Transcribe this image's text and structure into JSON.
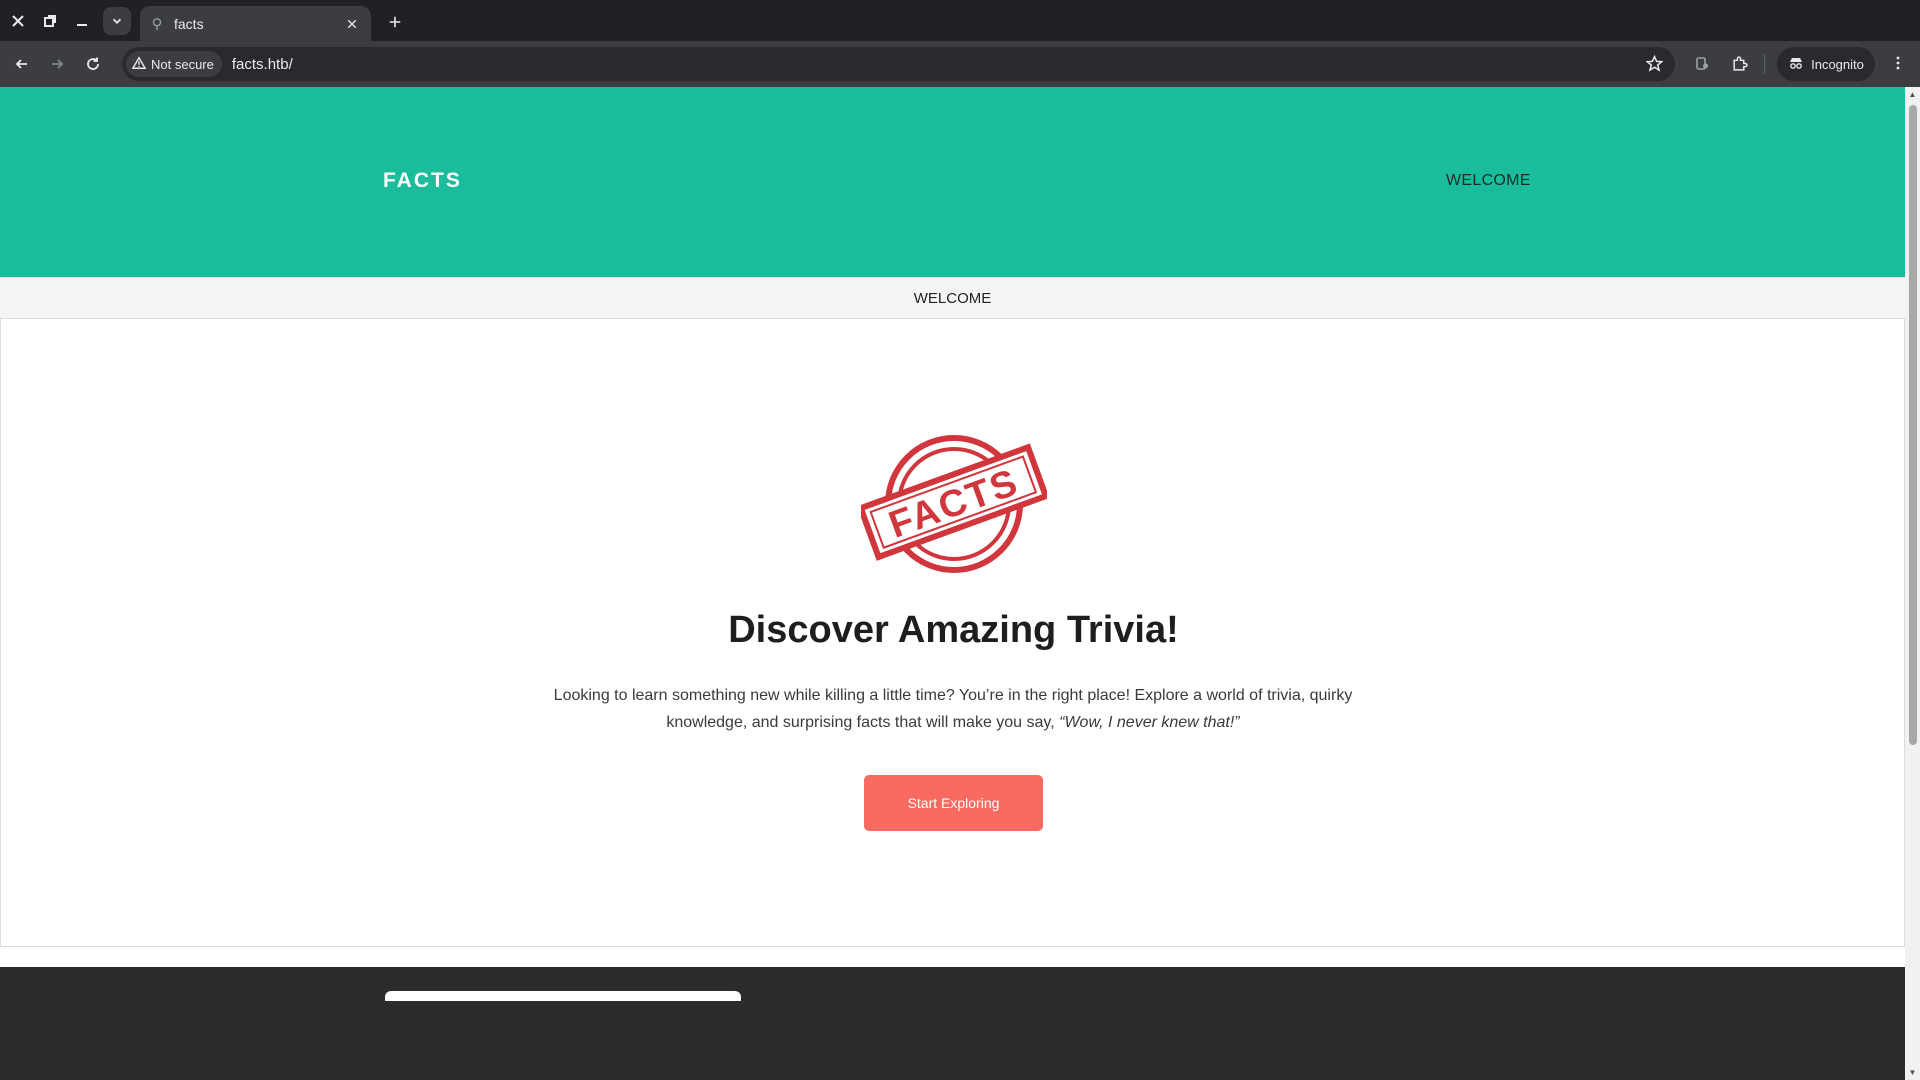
{
  "browser": {
    "tab_title": "facts",
    "security_label": "Not secure",
    "url": "facts.htb/",
    "incognito_label": "Incognito",
    "icons": [
      "close-icon",
      "restore-icon",
      "minimize-icon",
      "tab-search-icon",
      "new-tab-icon",
      "back-icon",
      "forward-icon",
      "reload-icon",
      "warning-icon",
      "star-icon",
      "passwords-icon",
      "extensions-icon",
      "incognito-icon",
      "menu-icon"
    ]
  },
  "site": {
    "brand": "FACTS",
    "header_nav": "WELCOME",
    "subnav": "WELCOME",
    "logo_text": "FACTS",
    "headline": "Discover Amazing Trivia!",
    "lead_text": "Looking to learn something new while killing a little time? You’re in the right place! Explore a world of trivia, quirky knowledge, and surprising facts that will make you say, ",
    "lead_quote": "“Wow, I never knew that!”",
    "cta_label": "Start Exploring"
  },
  "colors": {
    "header_bg": "#1abc9c",
    "cta_bg": "#f96b61",
    "logo_red": "#d0363c",
    "footer_bg": "#2c2c2c"
  }
}
